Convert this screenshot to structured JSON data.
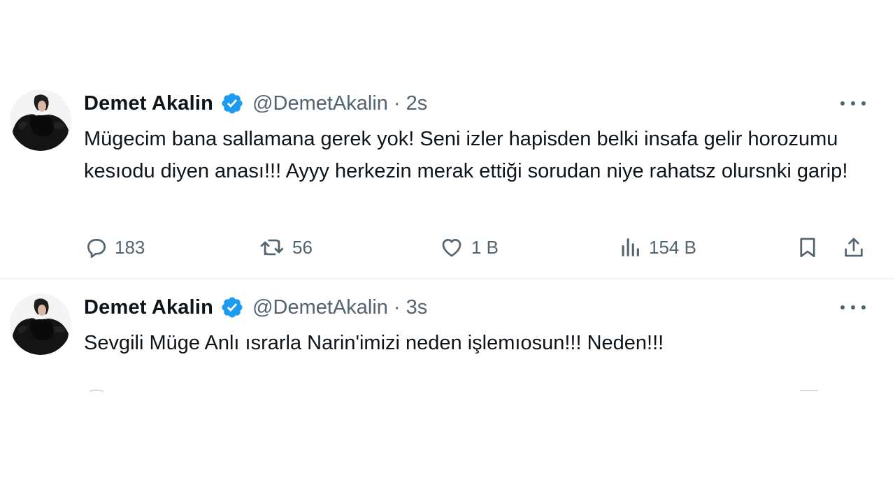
{
  "tweets": [
    {
      "name": "Demet Akalin",
      "handle": "@DemetAkalin",
      "separator": "·",
      "time": "2s",
      "text": "Mügecim bana sallamana gerek yok! Seni izler hapisden belki insafa gelir horozumu kesıodu diyen anası!!! Ayyy herkezin merak ettiği sorudan niye rahatsz olursnki garip!",
      "replies": "183",
      "retweets": "56",
      "likes": "1 B",
      "views": "154 B"
    },
    {
      "name": "Demet Akalin",
      "handle": "@DemetAkalin",
      "separator": "·",
      "time": "3s",
      "text": "Sevgili Müge Anlı ısrarla Narin'imizi neden işlemıosun!!! Neden!!!"
    }
  ],
  "icons": {
    "verified": "verified-badge-icon",
    "more": "more-options-icon",
    "reply": "reply-icon",
    "retweet": "retweet-icon",
    "like": "heart-icon",
    "views": "views-chart-icon",
    "bookmark": "bookmark-icon",
    "share": "share-icon"
  },
  "colors": {
    "verified": "#1d9bf0",
    "text": "#0f1419",
    "secondary": "#536471",
    "divider": "#eff3f4"
  }
}
